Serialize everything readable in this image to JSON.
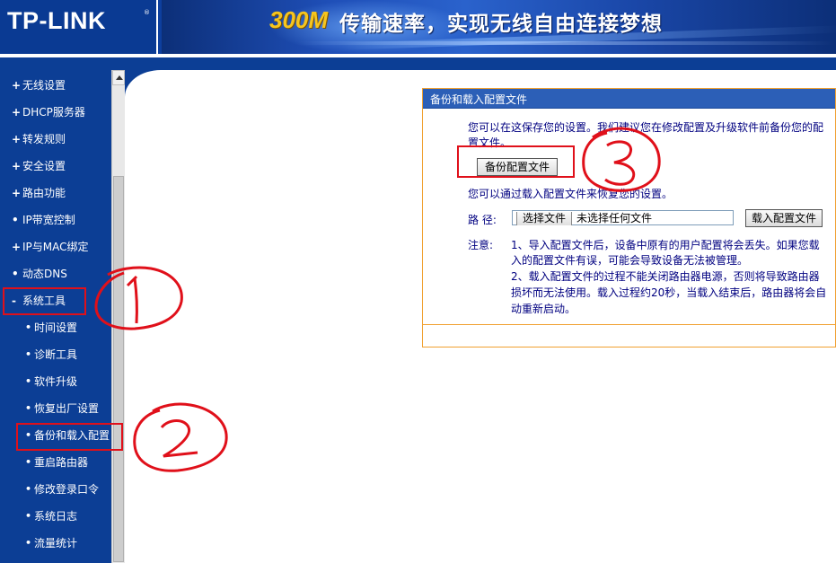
{
  "header": {
    "logo": "TP-LINK",
    "logo_reg": "®",
    "banner_highlight": "300M",
    "banner_slogan": "传输速率，实现无线自由连接梦想"
  },
  "sidebar": {
    "items": [
      {
        "label": "无线设置",
        "bullet": "+"
      },
      {
        "label": "DHCP服务器",
        "bullet": "+"
      },
      {
        "label": "转发规则",
        "bullet": "+"
      },
      {
        "label": "安全设置",
        "bullet": "+"
      },
      {
        "label": "路由功能",
        "bullet": "+"
      },
      {
        "label": "IP带宽控制",
        "bullet": "•"
      },
      {
        "label": "IP与MAC绑定",
        "bullet": "+"
      },
      {
        "label": "动态DNS",
        "bullet": "•"
      },
      {
        "label": "系统工具",
        "bullet": "-"
      }
    ],
    "subitems": [
      {
        "label": "时间设置",
        "bullet": "•"
      },
      {
        "label": "诊断工具",
        "bullet": "•"
      },
      {
        "label": "软件升级",
        "bullet": "•"
      },
      {
        "label": "恢复出厂设置",
        "bullet": "•"
      },
      {
        "label": "备份和载入配置",
        "bullet": "•"
      },
      {
        "label": "重启路由器",
        "bullet": "•"
      },
      {
        "label": "修改登录口令",
        "bullet": "•"
      },
      {
        "label": "系统日志",
        "bullet": "•"
      },
      {
        "label": "流量统计",
        "bullet": "•"
      }
    ]
  },
  "panel": {
    "title": "备份和载入配置文件",
    "backup_desc_line1": "您可以在这保存您的设置。我们建议您在修改配置及升级软件前备份您的配",
    "backup_desc_line2": "置文件。",
    "backup_button": "备份配置文件",
    "load_desc": "您可以通过载入配置文件来恢复您的设置。",
    "path_label": "路  径:",
    "choose_file_button": "选择文件",
    "no_file_text": "未选择任何文件",
    "load_button": "载入配置文件",
    "note_label": "注意:",
    "note_line1": "1、导入配置文件后，设备中原有的用户配置将会丢失。如果您载",
    "note_line2": "入的配置文件有误，可能会导致设备无法被管理。",
    "note_line3": "2、载入配置文件的过程不能关闭路由器电源，否则将导致路由器",
    "note_line4": "损坏而无法使用。载入过程约20秒，当载入结束后，路由器将会自",
    "note_line5": "动重新启动。"
  },
  "colors": {
    "nav_blue": "#0c3e95",
    "panel_title_blue": "#2c5fb7",
    "panel_border": "#f0a030",
    "annotation_red": "#e0101a",
    "banner_highlight": "#f6c51e"
  }
}
